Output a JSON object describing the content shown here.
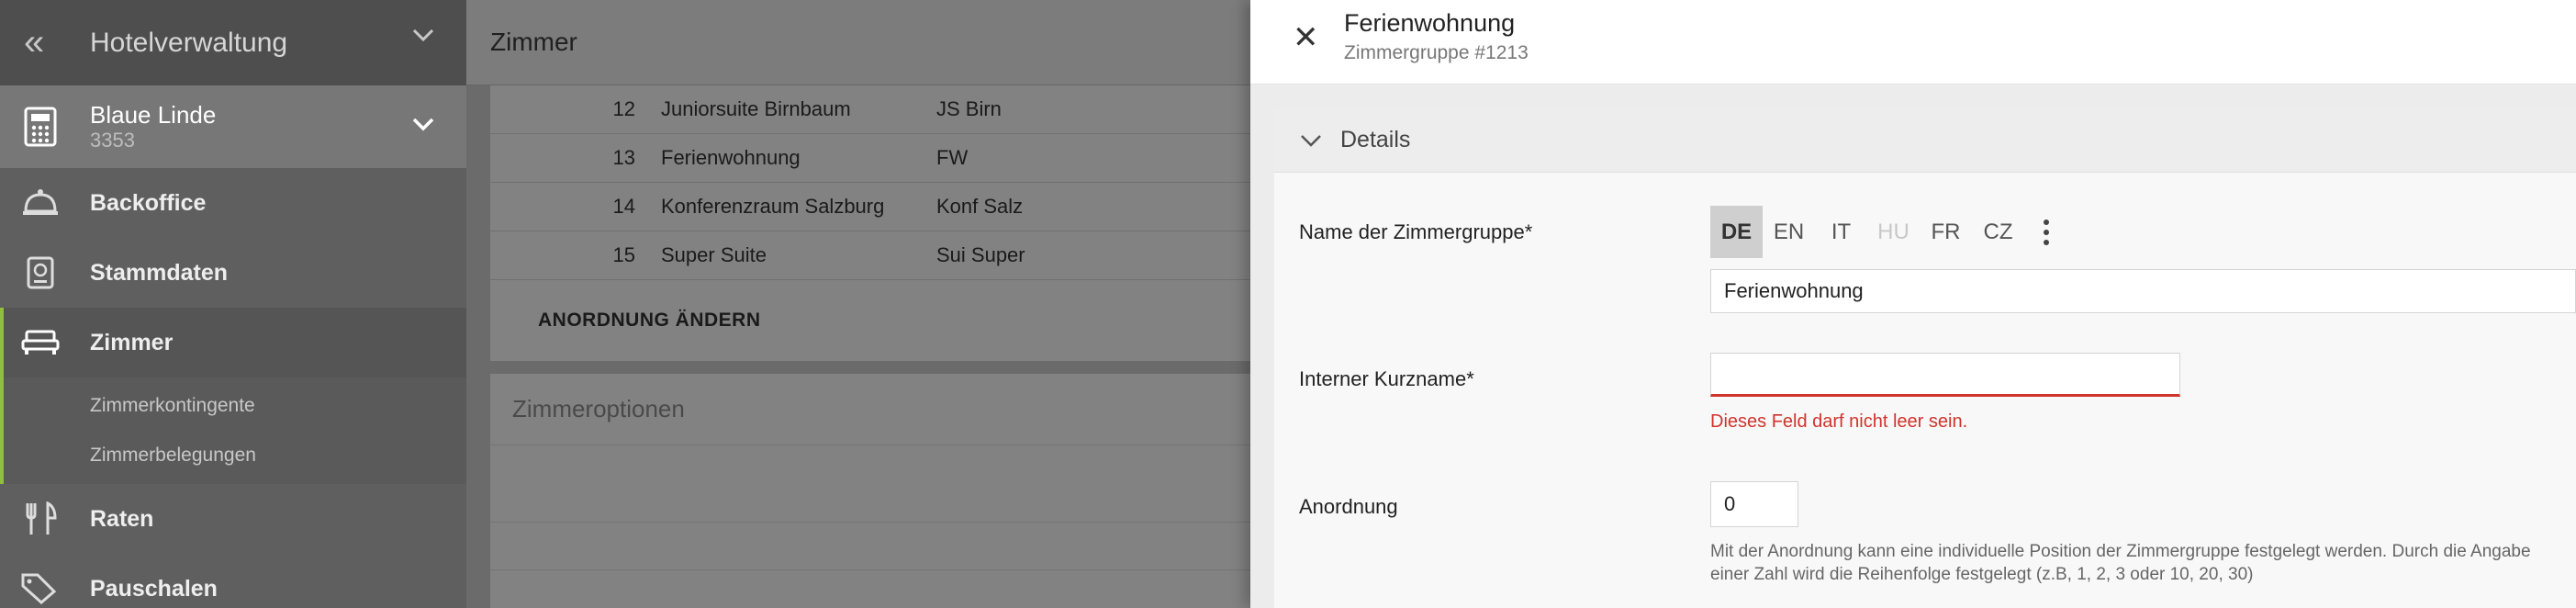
{
  "sidebar": {
    "collapse_icon": "double-chevron-left-icon",
    "app_title": "Hotelverwaltung",
    "hotel": {
      "name": "Blaue Linde",
      "number": "3353"
    },
    "nav": [
      {
        "label": "Backoffice",
        "icon": "bell-icon"
      },
      {
        "label": "Stammdaten",
        "icon": "passport-icon"
      },
      {
        "label": "Zimmer",
        "icon": "bed-icon",
        "active": true
      },
      {
        "label": "Raten",
        "icon": "cutlery-icon"
      },
      {
        "label": "Pauschalen",
        "icon": "tags-icon"
      }
    ],
    "sub_items": [
      {
        "label": "Zimmerkontingente"
      },
      {
        "label": "Zimmerbelegungen"
      }
    ]
  },
  "main": {
    "title": "Zimmer",
    "rooms": [
      {
        "order": "12",
        "name": "Juniorsuite Birnbaum",
        "short": "JS Birn"
      },
      {
        "order": "13",
        "name": "Ferienwohnung",
        "short": "FW"
      },
      {
        "order": "14",
        "name": "Konferenzraum Salzburg",
        "short": "Konf Salz"
      },
      {
        "order": "15",
        "name": "Super Suite",
        "short": "Sui Super"
      }
    ],
    "order_button": "ANORDNUNG ÄNDERN",
    "options_title": "Zimmeroptionen"
  },
  "drawer": {
    "title": "Ferienwohnung",
    "subtitle": "Zimmergruppe #1213",
    "section_title": "Details",
    "name_label": "Name der Zimmergruppe*",
    "languages": [
      {
        "code": "DE",
        "state": "active"
      },
      {
        "code": "EN",
        "state": "normal"
      },
      {
        "code": "IT",
        "state": "normal"
      },
      {
        "code": "HU",
        "state": "disabled"
      },
      {
        "code": "FR",
        "state": "normal"
      },
      {
        "code": "CZ",
        "state": "normal"
      }
    ],
    "name_value": "Ferienwohnung",
    "shortname_label": "Interner Kurzname*",
    "shortname_value": "",
    "shortname_error": "Dieses Feld darf nicht leer sein.",
    "order_label": "Anordnung",
    "order_value": "0",
    "order_help": "Mit der Anordnung kann eine individuelle Position der Zimmergruppe festgelegt werden. Durch die Angabe einer Zahl wird die Reihenfolge festgelegt (z.B, 1, 2, 3 oder 10, 20, 30)",
    "colors": {
      "error": "#d0342c",
      "active_accent": "#8fbf3c"
    }
  }
}
